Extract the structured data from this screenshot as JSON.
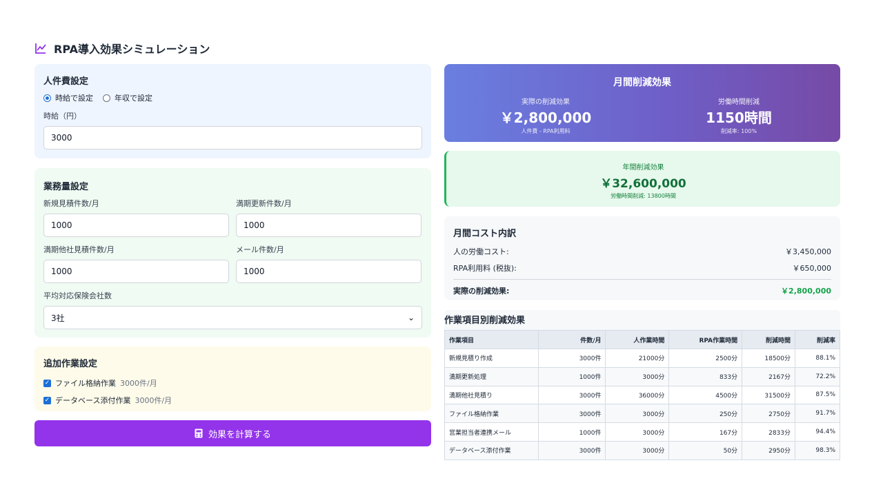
{
  "page": {
    "title": "RPA導入効果シミュレーション",
    "title_icon": "chart-line-icon"
  },
  "cost_settings": {
    "heading": "人件費設定",
    "radio_hourly": "時給で設定",
    "radio_annual": "年収で設定",
    "selected_mode": "hourly",
    "hourly_label": "時給（円）",
    "hourly_value": "3000"
  },
  "workload_settings": {
    "heading": "業務量設定",
    "new_quote_label": "新規見積件数/月",
    "new_quote_value": "1000",
    "renewal_label": "満期更新件数/月",
    "renewal_value": "1000",
    "other_quote_label": "満期他社見積件数/月",
    "other_quote_value": "1000",
    "mail_label": "メール件数/月",
    "mail_value": "1000",
    "insurer_label": "平均対応保険会社数",
    "insurer_value": "3社"
  },
  "extra_settings": {
    "heading": "追加作業設定",
    "items": [
      {
        "label": "ファイル格納作業",
        "detail": "3000件/月",
        "checked": true
      },
      {
        "label": "データベース添付作業",
        "detail": "3000件/月",
        "checked": true
      }
    ]
  },
  "calculate_button": {
    "label": "効果を計算する",
    "icon": "calculator-icon"
  },
  "monthly": {
    "title": "月間削減効果",
    "left_label": "実際の削減効果",
    "left_value": "￥2,800,000",
    "left_sub": "人件費 - RPA利用料",
    "right_label": "労働時間削減",
    "right_value": "1150時間",
    "right_sub": "削減率: 100%",
    "gradient": [
      "#6a7fe0",
      "#774aa6"
    ]
  },
  "annual": {
    "label": "年間削減効果",
    "value": "￥32,600,000",
    "sub": "労働時間削減: 13800時間",
    "accent": "#22b55b"
  },
  "breakdown": {
    "heading": "月間コスト内訳",
    "labor_label": "人の労働コスト:",
    "labor_value": "￥3,450,000",
    "rpa_label": "RPA利用料 (税抜):",
    "rpa_value": "￥650,000",
    "total_label": "実際の削減効果:",
    "total_value": "￥2,800,000"
  },
  "table": {
    "heading": "作業項目別削減効果",
    "headers": [
      "作業項目",
      "件数/月",
      "人作業時間",
      "RPA作業時間",
      "削減時間",
      "削減率"
    ],
    "rows": [
      [
        "新規見積り作成",
        "3000件",
        "21000分",
        "2500分",
        "18500分",
        "88.1%"
      ],
      [
        "満期更新処理",
        "1000件",
        "3000分",
        "833分",
        "2167分",
        "72.2%"
      ],
      [
        "満期他社見積り",
        "3000件",
        "36000分",
        "4500分",
        "31500分",
        "87.5%"
      ],
      [
        "ファイル格納作業",
        "3000件",
        "3000分",
        "250分",
        "2750分",
        "91.7%"
      ],
      [
        "営業担当者連携メール",
        "1000件",
        "3000分",
        "167分",
        "2833分",
        "94.4%"
      ],
      [
        "データベース添付作業",
        "3000件",
        "3000分",
        "50分",
        "2950分",
        "98.3%"
      ]
    ]
  },
  "colors": {
    "button": "#9333ea",
    "accent_blue": "#1d6fd6",
    "success_green": "#16a34a"
  }
}
